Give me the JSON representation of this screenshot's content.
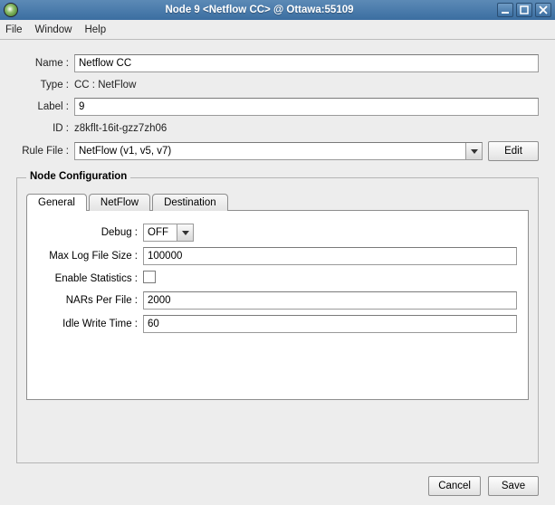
{
  "window": {
    "title": "Node 9 <Netflow CC> @ Ottawa:55109"
  },
  "menu": {
    "file": "File",
    "window": "Window",
    "help": "Help"
  },
  "form": {
    "name_label": "Name :",
    "name": "Netflow CC",
    "type_label": "Type :",
    "type": "CC : NetFlow",
    "label_label": "Label :",
    "label": "9",
    "id_label": "ID :",
    "id": "z8kflt-16it-gzz7zh06",
    "rule_label": "Rule File :",
    "rule": "NetFlow (v1, v5, v7)",
    "edit_btn": "Edit"
  },
  "fieldset": {
    "legend": "Node Configuration",
    "tabs": {
      "general": "General",
      "netflow": "NetFlow",
      "destination": "Destination"
    },
    "general": {
      "debug_label": "Debug :",
      "debug": "OFF",
      "maxlog_label": "Max Log File Size :",
      "maxlog": "100000",
      "stats_label": "Enable Statistics :",
      "nars_label": "NARs Per File :",
      "nars": "2000",
      "idle_label": "Idle Write Time :",
      "idle": "60"
    }
  },
  "footer": {
    "cancel": "Cancel",
    "save": "Save"
  }
}
